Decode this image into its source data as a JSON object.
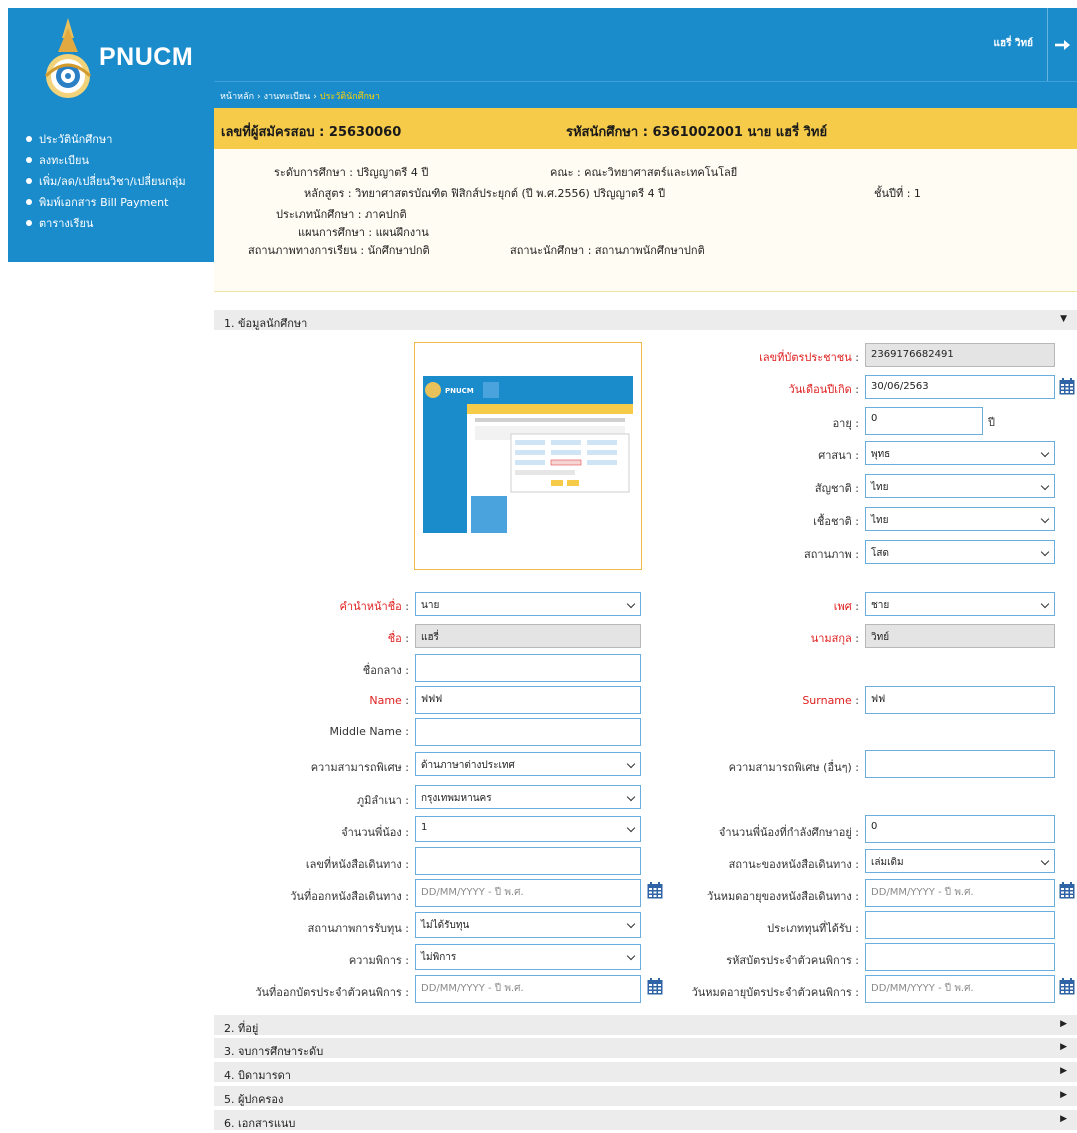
{
  "brand": {
    "name": "PNUCM"
  },
  "header": {
    "user_name": "แฮรี่ วิทย์"
  },
  "breadcrumb": [
    "หน้าหลัก",
    "งานทะเบียน",
    "ประวัตินักศึกษา"
  ],
  "sidebar": {
    "items": [
      {
        "label": "ประวัตินักศึกษา"
      },
      {
        "label": "ลงทะเบียน"
      },
      {
        "label": "เพิ่ม/ลด/เปลี่ยนวิชา/เปลี่ยนกลุ่ม"
      },
      {
        "label": "พิมพ์เอกสาร Bill Payment"
      },
      {
        "label": "ตารางเรียน"
      }
    ]
  },
  "summary": {
    "applicant": "เลขที่ผู้สมัครสอบ : 25630060",
    "student": "รหัสนักศึกษา : 6361002001 นาย แฮรี่ วิทย์"
  },
  "info": {
    "level": "ระดับการศึกษา : ปริญญาตรี 4 ปี",
    "faculty": "คณะ : คณะวิทยาศาสตร์และเทคโนโลยี",
    "curriculum": "หลักสูตร : วิทยาศาสตรบัณฑิต ฟิสิกส์ประยุกต์ (ปี พ.ศ.2556) ปริญญาตรี 4 ปี",
    "year": "ชั้นปีที่ : 1",
    "type": "ประเภทนักศึกษา : ภาคปกติ",
    "plan": "แผนการศึกษา : แผนฝึกงาน",
    "study_status": "สถานภาพทางการเรียน : นักศึกษาปกติ",
    "student_status": "สถานะนักศึกษา : สถานภาพนักศึกษาปกติ"
  },
  "sections": [
    {
      "label": "1. ข้อมูลนักศึกษา",
      "expanded": true
    },
    {
      "label": "2. ที่อยู่",
      "expanded": false
    },
    {
      "label": "3. จบการศึกษาระดับ",
      "expanded": false
    },
    {
      "label": "4. บิดามารดา",
      "expanded": false
    },
    {
      "label": "5. ผู้ปกครอง",
      "expanded": false
    },
    {
      "label": "6. เอกสารแนบ",
      "expanded": false
    }
  ],
  "form": {
    "id_card": {
      "label": "เลขที่บัตรประชาชน",
      "value": "2369176682491"
    },
    "birthdate": {
      "label": "วันเดือนปีเกิด",
      "value": "30/06/2563"
    },
    "age": {
      "label": "อายุ",
      "value": "0",
      "unit": "ปี"
    },
    "religion": {
      "label": "ศาสนา",
      "value": "พุทธ"
    },
    "nationality": {
      "label": "สัญชาติ",
      "value": "ไทย"
    },
    "race": {
      "label": "เชื้อชาติ",
      "value": "ไทย"
    },
    "marital": {
      "label": "สถานภาพ",
      "value": "โสด"
    },
    "prefix": {
      "label": "คำนำหน้าชื่อ",
      "value": "นาย"
    },
    "gender": {
      "label": "เพศ",
      "value": "ชาย"
    },
    "first_name": {
      "label": "ชื่อ",
      "value": "แฮรี่"
    },
    "last_name": {
      "label": "นามสกุล",
      "value": "วิทย์"
    },
    "middle_name_th": {
      "label": "ชื่อกลาง",
      "value": ""
    },
    "name_en": {
      "label": "Name",
      "value": "ฟฟฟ"
    },
    "surname_en": {
      "label": "Surname",
      "value": "ฟฟ"
    },
    "middle_name_en": {
      "label": "Middle Name",
      "value": ""
    },
    "talent": {
      "label": "ความสามารถพิเศษ",
      "value": "ด้านภาษาต่างประเทศ"
    },
    "talent_other": {
      "label": "ความสามารถพิเศษ (อื่นๆ)",
      "value": ""
    },
    "hometown": {
      "label": "ภูมิลำเนา",
      "value": "กรุงเทพมหานคร"
    },
    "siblings": {
      "label": "จำนวนพี่น้อง",
      "value": "1"
    },
    "siblings_studying": {
      "label": "จำนวนพี่น้องที่กำลังศึกษาอยู่",
      "value": "0"
    },
    "passport_no": {
      "label": "เลขที่หนังสือเดินทาง",
      "value": ""
    },
    "passport_status": {
      "label": "สถานะของหนังสือเดินทาง",
      "value": "เล่มเดิม"
    },
    "passport_issue": {
      "label": "วันที่ออกหนังสือเดินทาง",
      "placeholder": "DD/MM/YYYY - ปี พ.ศ."
    },
    "passport_expiry": {
      "label": "วันหมดอายุของหนังสือเดินทาง",
      "placeholder": "DD/MM/YYYY - ปี พ.ศ."
    },
    "scholarship_status": {
      "label": "สถานภาพการรับทุน",
      "value": "ไม่ได้รับทุน"
    },
    "scholarship_type": {
      "label": "ประเภททุนที่ได้รับ",
      "value": ""
    },
    "disability": {
      "label": "ความพิการ",
      "value": "ไม่พิการ"
    },
    "disability_card": {
      "label": "รหัสบัตรประจำตัวคนพิการ",
      "value": ""
    },
    "disability_issue": {
      "label": "วันที่ออกบัตรประจำตัวคนพิการ",
      "placeholder": "DD/MM/YYYY - ปี พ.ศ."
    },
    "disability_expiry": {
      "label": "วันหมดอายุบัตรประจำตัวคนพิการ",
      "placeholder": "DD/MM/YYYY - ปี พ.ศ."
    }
  },
  "photo": {
    "caption": "PNUCM"
  },
  "colors": {
    "primary": "#1a8ccc",
    "accent": "#f6cb4a",
    "breadcrumb_current": "#ffd200",
    "required_label": "#e02020",
    "field_border": "#6aaee0"
  }
}
